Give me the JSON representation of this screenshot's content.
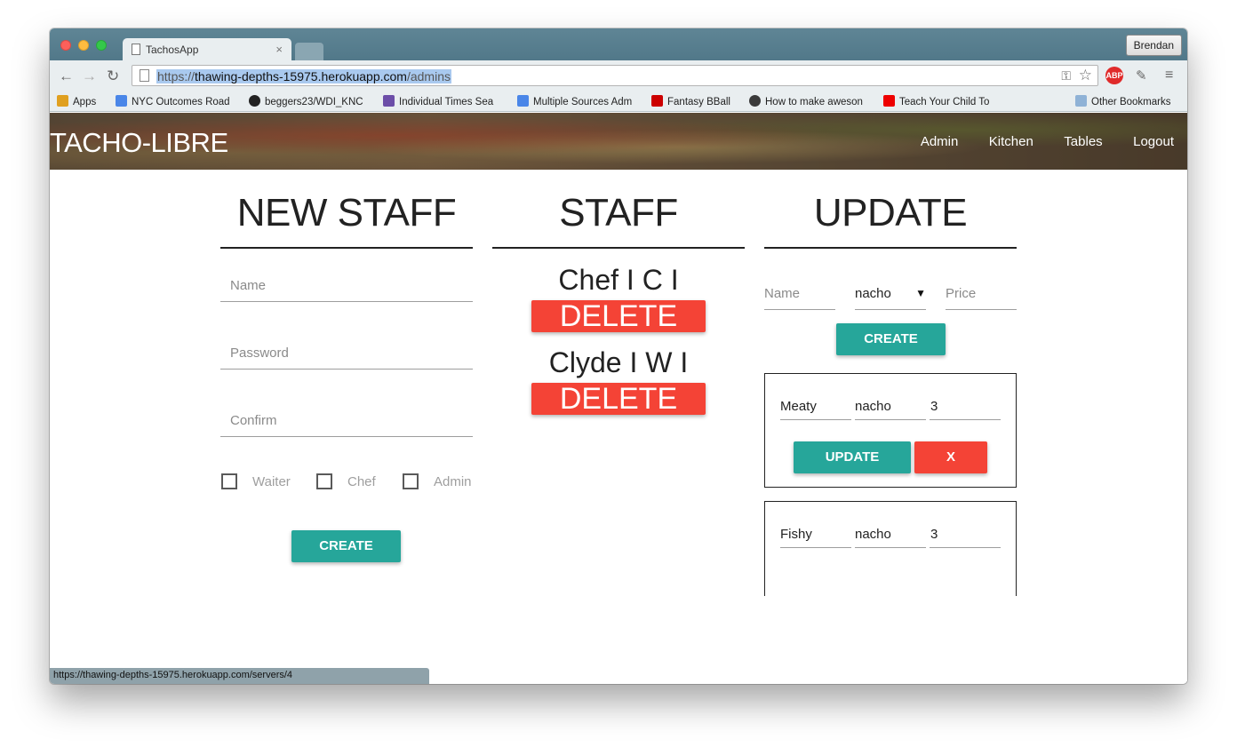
{
  "browser": {
    "tab_title": "TachosApp",
    "tab_close": "×",
    "profile": "Brendan",
    "url_scheme": "https://",
    "url_host": "thawing-depths-15975.herokuapp.com",
    "url_path": "/admins",
    "status_url": "https://thawing-depths-15975.herokuapp.com/servers/4",
    "ext_abp": "ABP"
  },
  "bookmarks": [
    {
      "label": "Apps",
      "color": "#e0a020"
    },
    {
      "label": "NYC Outcomes Road",
      "color": "#4a86e8"
    },
    {
      "label": "beggers23/WDI_KNC",
      "color": "#222222"
    },
    {
      "label": "Individual Times Sea",
      "color": "#6c4ea8"
    },
    {
      "label": "Multiple Sources Adm",
      "color": "#4a86e8"
    },
    {
      "label": "Fantasy BBall",
      "color": "#cc0000"
    },
    {
      "label": "How to make aweson",
      "color": "#3a3a3a"
    },
    {
      "label": "Teach Your Child To",
      "color": "#ee0000"
    },
    {
      "label": "Other Bookmarks",
      "color": "#8fb2d6"
    }
  ],
  "navbar": {
    "brand": "TACHO-LIBRE",
    "links": [
      "Admin",
      "Kitchen",
      "Tables",
      "Logout"
    ]
  },
  "new_staff": {
    "title": "NEW STAFF",
    "name_placeholder": "Name",
    "password_placeholder": "Password",
    "confirm_placeholder": "Confirm",
    "roles": [
      "Waiter",
      "Chef",
      "Admin"
    ],
    "create_label": "CREATE"
  },
  "staff": {
    "title": "STAFF",
    "members": [
      {
        "name": "Chef I C I",
        "delete_label": "DELETE"
      },
      {
        "name": "Clyde I W I",
        "delete_label": "DELETE"
      }
    ]
  },
  "update": {
    "title": "UPDATE",
    "name_placeholder": "Name",
    "type_selected": "nacho",
    "price_placeholder": "Price",
    "create_label": "CREATE",
    "items": [
      {
        "name": "Meaty",
        "type": "nacho",
        "price": "3",
        "update_label": "UPDATE",
        "remove_label": "X"
      },
      {
        "name": "Fishy",
        "type": "nacho",
        "price": "3"
      }
    ]
  }
}
